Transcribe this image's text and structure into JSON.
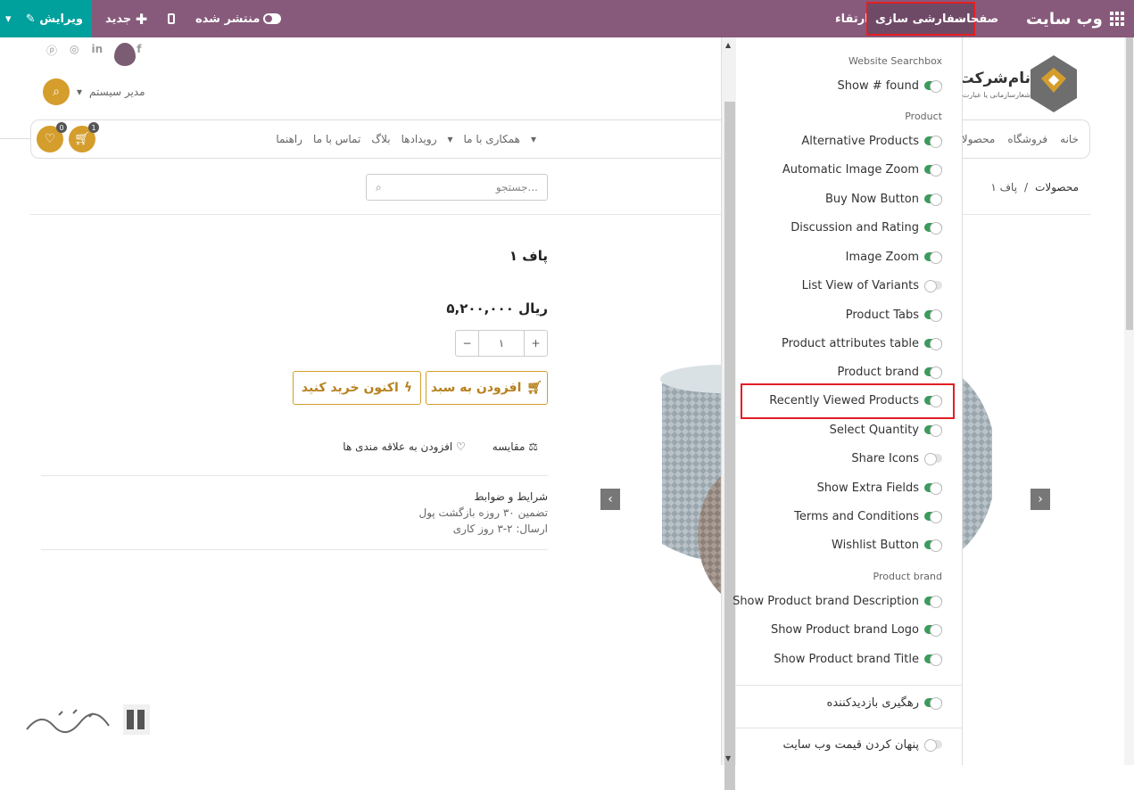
{
  "topbar": {
    "app_title": "وب سایت",
    "pages": "صفحات",
    "customize": "سفارشی سازی",
    "upgrade": "ارتقاء",
    "published": "منتشر شده",
    "new": "جدید",
    "edit": "ویرایش"
  },
  "header": {
    "user": "مدیر سیستم",
    "company_name": "نام‌شرکت‌ه",
    "company_tagline": "شعارسازمانی یا عبارت‌ه",
    "cart_count": "1",
    "wishlist_count": "0",
    "nav": [
      "خانه",
      "فروشگاه",
      "محصولات"
    ],
    "nav2": [
      "همکاری با ما",
      "رویدادها",
      "بلاگ",
      "تماس با ما",
      "راهنما"
    ]
  },
  "breadcrumb": {
    "parent": "محصولات",
    "current": "پاف ۱",
    "sep": "/"
  },
  "search": {
    "placeholder": "جستجو..."
  },
  "product": {
    "title": "پاف ۱",
    "price": "۵,۲۰۰,۰۰۰ ریال",
    "qty": "۱",
    "add_to_cart": "افزودن به سبد",
    "buy_now": "اکنون خرید کنید",
    "compare": "مقایسه",
    "wishlist": "افزودن به علاقه مندی ها",
    "terms_title": "شرایط و ضوابط",
    "terms_line1": "تضمین ۳۰ روزه بازگشت پول",
    "terms_line2": "ارسال: ۲-۳ روز کاری"
  },
  "panel": {
    "sections": [
      {
        "title": "Website Searchbox",
        "options": [
          {
            "label": "Show # found",
            "on": true
          }
        ]
      },
      {
        "title": "Product",
        "options": [
          {
            "label": "Alternative Products",
            "on": true
          },
          {
            "label": "Automatic Image Zoom",
            "on": true
          },
          {
            "label": "Buy Now Button",
            "on": true
          },
          {
            "label": "Discussion and Rating",
            "on": true
          },
          {
            "label": "Image Zoom",
            "on": true
          },
          {
            "label": "List View of Variants",
            "on": false
          },
          {
            "label": "Product Tabs",
            "on": true
          },
          {
            "label": "Product attributes table",
            "on": true
          },
          {
            "label": "Product brand",
            "on": true
          },
          {
            "label": "Recently Viewed Products",
            "on": true
          },
          {
            "label": "Select Quantity",
            "on": true
          },
          {
            "label": "Share Icons",
            "on": false
          },
          {
            "label": "Show Extra Fields",
            "on": true
          },
          {
            "label": "Terms and Conditions",
            "on": true
          },
          {
            "label": "Wishlist Button",
            "on": true
          }
        ]
      },
      {
        "title": "Product brand",
        "options": [
          {
            "label": "Show Product brand Description",
            "on": true
          },
          {
            "label": "Show Product brand Logo",
            "on": true
          },
          {
            "label": "Show Product brand Title",
            "on": true
          }
        ]
      }
    ],
    "visitor_tracking": {
      "label": "رهگیری بازدیدکننده",
      "on": true
    },
    "hide_prices": {
      "label": "پنهان کردن قیمت وب سایت",
      "on": false
    }
  },
  "colors": {
    "admin_bar": "#875a7b",
    "edit": "#00a09d",
    "accent": "#d49d2c",
    "toggle_on": "#3a9b5c",
    "highlight": "#e31e24"
  }
}
